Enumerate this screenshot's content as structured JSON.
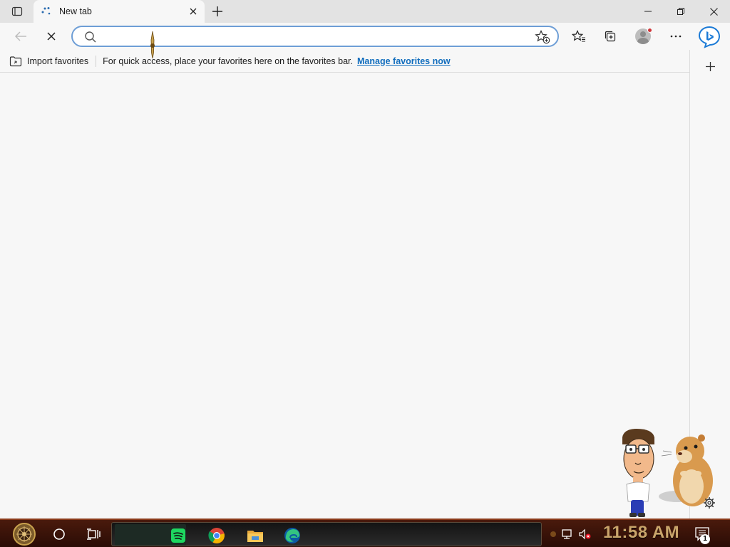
{
  "browser": {
    "tab": {
      "title": "New tab"
    },
    "address_bar": {
      "value": "",
      "placeholder": ""
    },
    "favorites_bar": {
      "import_label": "Import favorites",
      "hint_text": "For quick access, place your favorites here on the favorites bar.",
      "manage_link": "Manage favorites now"
    },
    "toolbar_icons": [
      "back-icon",
      "stop-loading-icon",
      "favorites-icon",
      "collections-icon",
      "profile-icon",
      "more-options-icon",
      "bing-copilot-icon"
    ],
    "accent_color": "#0f6cbd"
  },
  "taskbar": {
    "clock": "11:58 AM",
    "notification_count": "1",
    "pinned_apps": [
      "spotify-icon",
      "chrome-icon",
      "file-explorer-icon",
      "edge-icon"
    ]
  }
}
